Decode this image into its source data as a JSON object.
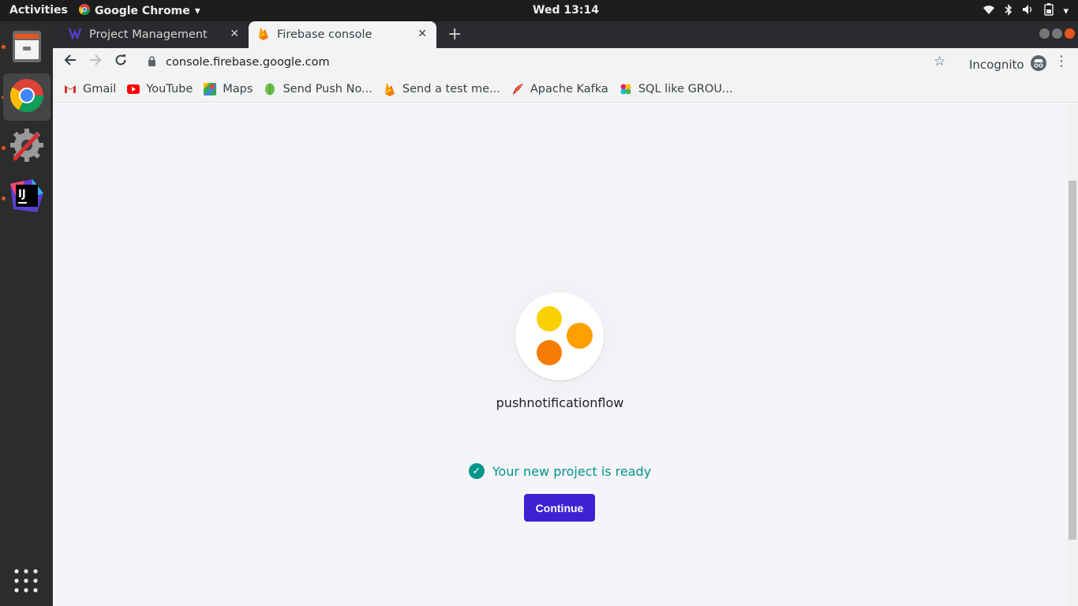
{
  "topbar": {
    "activities": "Activities",
    "app_name": "Google Chrome",
    "clock": "Wed 13:14"
  },
  "dock": {
    "items": [
      "file-cabinet-icon",
      "chrome-icon",
      "settings-tools-icon",
      "intellij-icon"
    ],
    "apps_grid": "show-applications-icon"
  },
  "tabs": [
    {
      "title": "Project Management",
      "active": false
    },
    {
      "title": "Firebase console",
      "active": true
    }
  ],
  "toolbar": {
    "url": "console.firebase.google.com",
    "incognito_label": "Incognito"
  },
  "bookmarks": [
    {
      "label": "Gmail",
      "icon": "gmail-icon"
    },
    {
      "label": "YouTube",
      "icon": "youtube-icon"
    },
    {
      "label": "Maps",
      "icon": "maps-icon"
    },
    {
      "label": "Send Push No...",
      "icon": "leaf-icon"
    },
    {
      "label": "Send a test me...",
      "icon": "firebase-icon"
    },
    {
      "label": "Apache Kafka",
      "icon": "kafka-icon"
    },
    {
      "label": "SQL like GROU...",
      "icon": "sql-icon"
    }
  ],
  "main": {
    "project_name": "pushnotificationflow",
    "status_text": "Your new project is ready",
    "continue_label": "Continue"
  },
  "colors": {
    "accent_button": "#3f20d3",
    "success": "#009688",
    "dot_yellow": "#fbd000",
    "dot_amber": "#ffa000",
    "dot_orange": "#f57c00"
  }
}
